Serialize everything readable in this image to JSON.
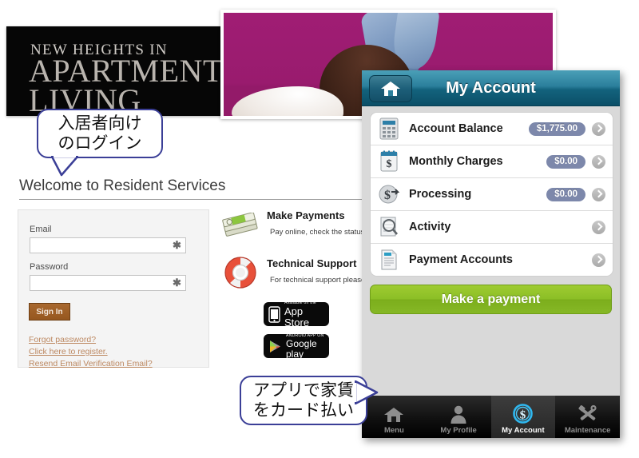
{
  "site": {
    "brand": {
      "line1": "NEW HEIGHTS IN",
      "line2": "APARTMENT",
      "line3": "LIVING"
    },
    "welcome_heading": "Welcome to Resident Services",
    "login": {
      "email_label": "Email",
      "email_value": "",
      "email_required_mark": "✱",
      "password_label": "Password",
      "password_value": "",
      "password_required_mark": "✱",
      "signin_label": "Sign In",
      "links": [
        "Forgot password?",
        "Click here to register.",
        "Resend Email Verification Email?"
      ]
    },
    "features": [
      {
        "icon": "money-stack-icon",
        "title": "Make Payments",
        "desc": "Pay online, check the status"
      },
      {
        "icon": "lifebuoy-icon",
        "title": "Technical Support",
        "desc": "For technical support please"
      }
    ],
    "store_badges": [
      {
        "icon": "apple-iphone-icon",
        "small": "Available on the",
        "big": "App Store"
      },
      {
        "icon": "google-play-triangle-icon",
        "small": "ANDROID APP ON",
        "big": "Google play"
      }
    ]
  },
  "phone": {
    "home_icon": "home-icon",
    "title": "My Account",
    "rows": [
      {
        "icon": "calculator-icon",
        "label": "Account Balance",
        "badge": "$1,775.00",
        "chevron": "chevron-right-icon"
      },
      {
        "icon": "calendar-dollar-icon",
        "label": "Monthly Charges",
        "badge": "$0.00",
        "chevron": "chevron-right-icon"
      },
      {
        "icon": "dollar-arrow-icon",
        "label": "Processing",
        "badge": "$0.00",
        "chevron": "chevron-right-icon"
      },
      {
        "icon": "magnifier-page-icon",
        "label": "Activity",
        "badge": "",
        "chevron": "chevron-right-icon"
      },
      {
        "icon": "document-icon",
        "label": "Payment Accounts",
        "badge": "",
        "chevron": "chevron-right-icon"
      }
    ],
    "pay_button": "Make a payment",
    "tabs": [
      {
        "icon": "home-icon",
        "label": "Menu",
        "active": false
      },
      {
        "icon": "person-icon",
        "label": "My Profile",
        "active": false
      },
      {
        "icon": "dollar-circle-icon",
        "label": "My Account",
        "active": true
      },
      {
        "icon": "tools-icon",
        "label": "Maintenance",
        "active": false
      }
    ]
  },
  "callouts": [
    {
      "line1": "入居者向け",
      "line2": "のログイン"
    },
    {
      "line1": "アプリで家賃",
      "line2": "をカード払い"
    }
  ],
  "colors": {
    "callout_border": "#3b3f97",
    "phone_header_teal": "#13627d",
    "pay_green": "#8cbf26",
    "badge_slate": "#7d88ab",
    "signin_brown": "#96571f",
    "link_tan": "#bd8962",
    "hero_magenta": "#9c1c72"
  }
}
